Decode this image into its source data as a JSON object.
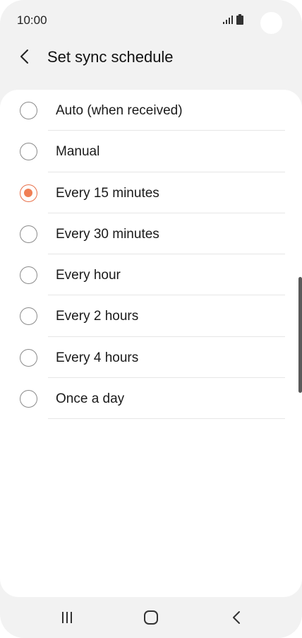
{
  "status_bar": {
    "time": "10:00",
    "icons": [
      "signal-icon",
      "battery-icon"
    ]
  },
  "header": {
    "title": "Set sync schedule",
    "back_icon": "chevron-left-icon"
  },
  "options": [
    {
      "label": "Auto (when received)",
      "selected": false
    },
    {
      "label": "Manual",
      "selected": false
    },
    {
      "label": "Every 15 minutes",
      "selected": true
    },
    {
      "label": "Every 30 minutes",
      "selected": false
    },
    {
      "label": "Every hour",
      "selected": false
    },
    {
      "label": "Every 2 hours",
      "selected": false
    },
    {
      "label": "Every 4 hours",
      "selected": false
    },
    {
      "label": "Once a day",
      "selected": false
    }
  ],
  "nav_bar": {
    "icons": [
      "recents-icon",
      "home-icon",
      "back-icon"
    ]
  },
  "colors": {
    "accent": "#f07f55",
    "background": "#f2f2f2",
    "card": "#ffffff"
  }
}
